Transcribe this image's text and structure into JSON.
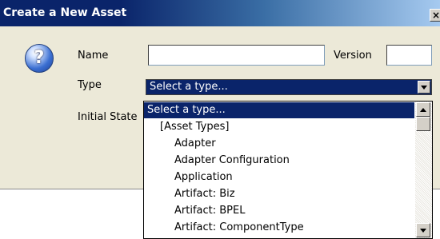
{
  "window": {
    "title": "Create a New Asset",
    "close_glyph": "×"
  },
  "form": {
    "help_glyph": "?",
    "name_label": "Name",
    "name_value": "",
    "version_label": "Version",
    "version_value": "",
    "type_label": "Type",
    "type_selected": "Select a type...",
    "initial_state_label": "Initial State"
  },
  "type_dropdown": {
    "items": [
      {
        "label": "Select a type...",
        "selected": true,
        "indent": 0
      },
      {
        "label": "[Asset Types]",
        "selected": false,
        "indent": 1
      },
      {
        "label": "Adapter",
        "selected": false,
        "indent": 2
      },
      {
        "label": "Adapter Configuration",
        "selected": false,
        "indent": 2
      },
      {
        "label": "Application",
        "selected": false,
        "indent": 2
      },
      {
        "label": "Artifact: Biz",
        "selected": false,
        "indent": 2
      },
      {
        "label": "Artifact: BPEL",
        "selected": false,
        "indent": 2
      },
      {
        "label": "Artifact: ComponentType",
        "selected": false,
        "indent": 2
      }
    ]
  },
  "colors": {
    "selection": "#0a246a",
    "dialog_bg": "#ece9d8",
    "title_gradient_start": "#0a246a",
    "title_gradient_end": "#a6caf0"
  }
}
